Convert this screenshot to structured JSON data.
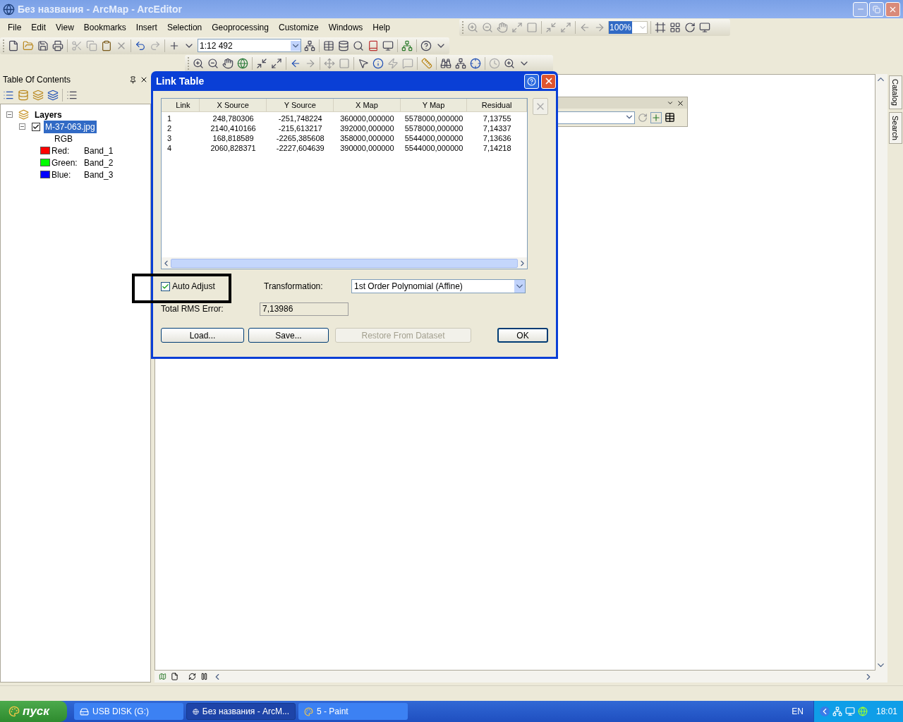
{
  "window": {
    "title": "Без названия - ArcMap - ArcEditor"
  },
  "menu": [
    "File",
    "Edit",
    "View",
    "Bookmarks",
    "Insert",
    "Selection",
    "Geoprocessing",
    "Customize",
    "Windows",
    "Help"
  ],
  "standard_toolbar": {
    "scale": "1:12 492"
  },
  "layout_toolbar": {
    "zoom": "100%"
  },
  "toc": {
    "title": "Table Of Contents",
    "tree": [
      {
        "kind": "group",
        "label": "Layers",
        "expanded": true,
        "children": [
          {
            "kind": "layer",
            "label": "M-37-063.jpg",
            "checked": true,
            "selected": true,
            "expanded": true,
            "children": [
              {
                "kind": "heading",
                "label": "RGB"
              },
              {
                "kind": "band",
                "label": "Red:",
                "band": "Band_1",
                "color": "#ff0000"
              },
              {
                "kind": "band",
                "label": "Green:",
                "band": "Band_2",
                "color": "#00ff00"
              },
              {
                "kind": "band",
                "label": "Blue:",
                "band": "Band_3",
                "color": "#0000ff"
              }
            ]
          }
        ]
      }
    ]
  },
  "side_tabs": [
    "Catalog",
    "Search"
  ],
  "dialog": {
    "title": "Link Table",
    "columns": [
      "Link",
      "X Source",
      "Y Source",
      "X Map",
      "Y Map",
      "Residual"
    ],
    "rows": [
      [
        "1",
        "248,780306",
        "-251,748224",
        "360000,000000",
        "5578000,000000",
        "7,13755"
      ],
      [
        "2",
        "2140,410166",
        "-215,613217",
        "392000,000000",
        "5578000,000000",
        "7,14337"
      ],
      [
        "3",
        "168,818589",
        "-2265,385608",
        "358000,000000",
        "5544000,000000",
        "7,13636"
      ],
      [
        "4",
        "2060,828371",
        "-2227,604639",
        "390000,000000",
        "5544000,000000",
        "7,14218"
      ]
    ],
    "auto_adjust": {
      "label": "Auto Adjust",
      "checked": true
    },
    "transformation": {
      "label": "Transformation:",
      "value": "1st Order Polynomial (Affine)"
    },
    "rms": {
      "label": "Total RMS Error:",
      "value": "7,13986"
    },
    "buttons": [
      {
        "label": "Load...",
        "disabled": false,
        "default": false
      },
      {
        "label": "Save...",
        "disabled": false,
        "default": false
      },
      {
        "label": "Restore From Dataset",
        "disabled": true,
        "default": false
      },
      {
        "label": "OK",
        "disabled": false,
        "default": true
      }
    ]
  },
  "taskbar": {
    "start": "пуск",
    "tasks": [
      {
        "label": "USB DISK (G:)",
        "selected": false
      },
      {
        "label": "Без названия - ArcM...",
        "selected": true
      },
      {
        "label": "5 - Paint",
        "selected": false
      }
    ],
    "language": "EN",
    "clock": "18:01"
  }
}
